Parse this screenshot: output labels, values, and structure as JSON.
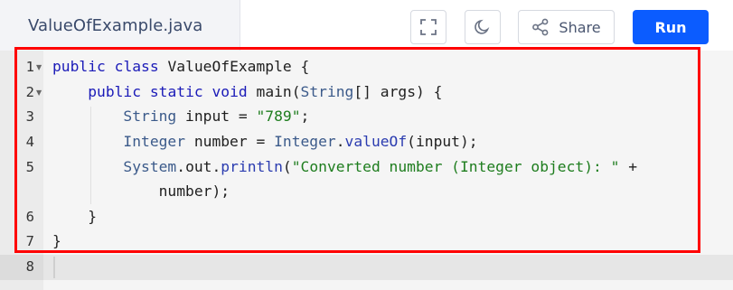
{
  "header": {
    "file_name": "ValueOfExample.java",
    "fullscreen_icon": "fullscreen-icon",
    "theme_icon": "moon-icon",
    "share_icon": "share-icon",
    "share_label": "Share",
    "run_label": "Run",
    "run_color": "#0b5cff"
  },
  "editor": {
    "line_numbers": [
      "1",
      "2",
      "3",
      "4",
      "5",
      "6",
      "7",
      "8"
    ],
    "lines": [
      "public class ValueOfExample {",
      "    public static void main(String[] args) {",
      "        String input = \"789\";",
      "        Integer number = Integer.valueOf(input);",
      "        System.out.println(\"Converted number (Integer object): \" +",
      "            number);",
      "    }",
      "}"
    ],
    "highlight_color": "#ff0000"
  }
}
